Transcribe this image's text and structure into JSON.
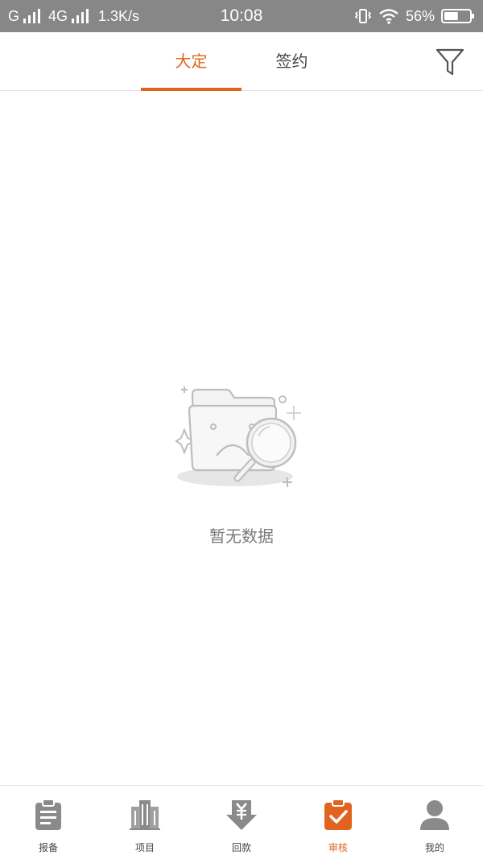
{
  "status_bar": {
    "carrier_1": "G",
    "carrier_2": "4G",
    "speed": "1.3K/s",
    "time": "10:08",
    "battery": "56%",
    "battery_level": 0.56
  },
  "header": {
    "tabs": [
      {
        "label": "大定",
        "active": true
      },
      {
        "label": "签约",
        "active": false
      }
    ],
    "filter_icon": "filter-icon"
  },
  "empty_state": {
    "icon": "empty-folder-search-icon",
    "message": "暂无数据"
  },
  "bottom_nav": {
    "items": [
      {
        "label": "报备",
        "icon": "clipboard-icon",
        "active": false
      },
      {
        "label": "项目",
        "icon": "building-icon",
        "active": false
      },
      {
        "label": "回款",
        "icon": "yen-download-icon",
        "active": false
      },
      {
        "label": "审核",
        "icon": "check-clipboard-icon",
        "active": true
      },
      {
        "label": "我的",
        "icon": "user-icon",
        "active": false
      }
    ]
  },
  "colors": {
    "accent": "#e0641f",
    "icon_gray": "#8a8a8a",
    "status_bar_bg": "#878787"
  }
}
